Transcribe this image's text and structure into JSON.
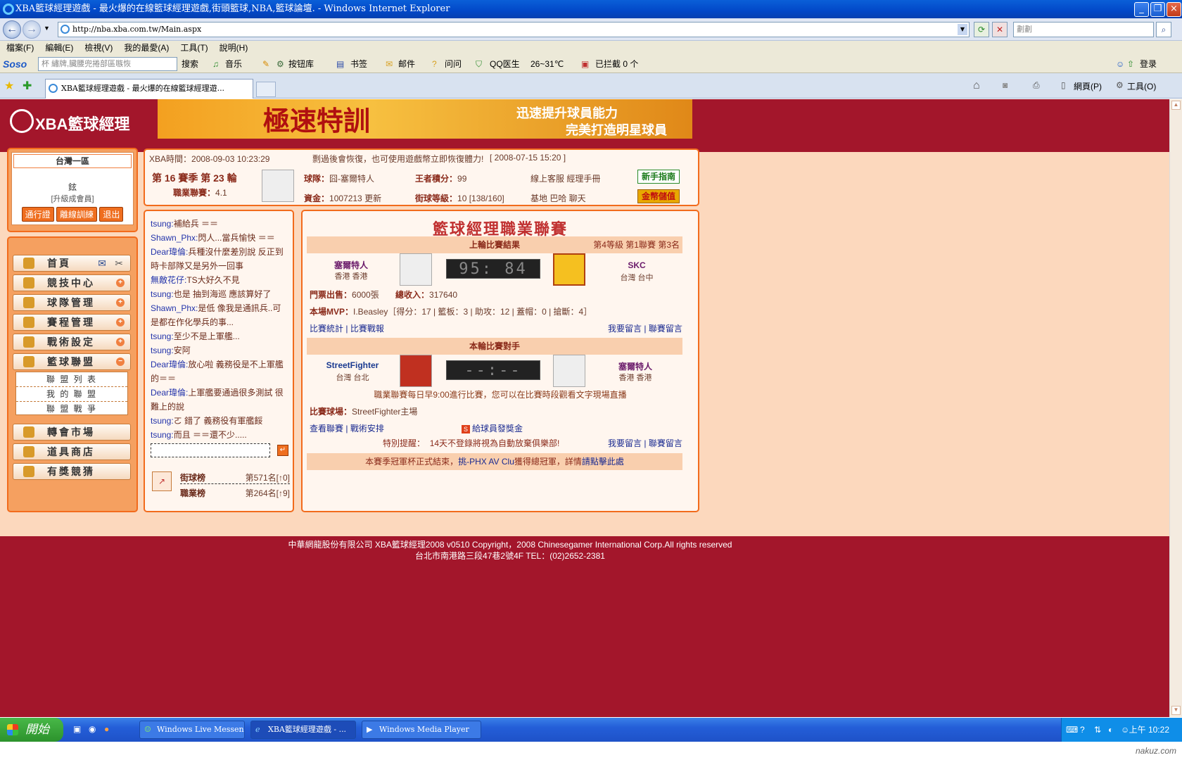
{
  "window": {
    "title": "XBA籃球經理遊戲 - 最火爆的在線籃球經理遊戲,街頭籃球,NBA,籃球論壇. - Windows Internet Explorer"
  },
  "browser": {
    "url": "http://nba.xba.com.tw/Main.aspx",
    "search_placeholder": "劃劃",
    "menu": [
      "檔案(F)",
      "編輯(E)",
      "檢視(V)",
      "我的最愛(A)",
      "工具(T)",
      "說明(H)"
    ],
    "soso": {
      "brand": "Soso",
      "input": "杯 繡牌,臟腰兜捲部區嗾恢",
      "search": "搜索",
      "music": "音乐",
      "bookmarks": "按钮库",
      "links": "书签",
      "mail": "邮件",
      "ask": "问问",
      "qq": "QQ医生",
      "weather": "26~31℃",
      "blocked": "已拦截 0 个",
      "login": "登录"
    },
    "tab": "XBA籃球經理遊戲 - 最火爆的在線籃球經理遊...",
    "page_menu": "網頁(P)",
    "tools_menu": "工具(O)"
  },
  "site": {
    "logo": "XBA籃球經理",
    "banner_title": "極速特訓",
    "banner_line1": "迅速提升球員能力",
    "banner_line2": "完美打造明星球員"
  },
  "left": {
    "server": "台灣一區",
    "user": "鉉",
    "upgrade": "[升級成會員]",
    "btns": [
      "通行證",
      "離線訓練",
      "退出"
    ],
    "menu": [
      "首頁",
      "競技中心",
      "球隊管理",
      "賽程管理",
      "戰術設定",
      "籃球聯盟",
      "轉會市場",
      "道具商店",
      "有獎競猜"
    ],
    "sub": [
      "聯 盟 列 表",
      "我 的 聯 盟",
      "聯 盟 戰 爭"
    ]
  },
  "info": {
    "time_label": "XBA時間：",
    "time": "2008-09-03 10:23:29",
    "notice": "剽過後會恢復，也可使用遊戲幣立即恢復體力!",
    "notice_date": "[ 2008-07-15 15:20 ]",
    "season": "第 16 賽季 第 23 輪",
    "league_label": "職業聯賽：",
    "league_val": "4.1",
    "team_label": "球隊：",
    "team_val": "囧-塞爾特人",
    "kings_label": "王者積分：",
    "kings_val": "99",
    "service": "線上客服 經理手冊",
    "money_label": "資金：",
    "money_val": "1007213",
    "update": "更新",
    "street_label": "街球等級：",
    "street_val": "10 [138/160]",
    "base": "基地 巴哈 聊天",
    "guide": "新手指南",
    "gold": "金幣儲值"
  },
  "chat": [
    {
      "u": "tsung:",
      "t": "補給兵 ＝＝"
    },
    {
      "u": "Shawn_Phx:",
      "t": "閃人...當兵愉快 ＝＝"
    },
    {
      "u": "Dear瑋倫:",
      "t": "兵種沒什麼差別說 反正到時卡部隊又是另外一回事"
    },
    {
      "u": "無敵花仔:",
      "t": "TS大好久不見"
    },
    {
      "u": "tsung:",
      "t": "也是 抽到海巡 應該算好了"
    },
    {
      "u": "Shawn_Phx:",
      "t": "是低 像我是通訊兵..可是都在作化學兵的事..."
    },
    {
      "u": "tsung:",
      "t": "至少不是上軍艦..."
    },
    {
      "u": "tsung:",
      "t": "安阿"
    },
    {
      "u": "Dear瑋倫:",
      "t": "放心啦 義務役是不上軍艦的＝＝"
    },
    {
      "u": "Dear瑋倫:",
      "t": "上軍艦要通過很多測試 很難上的說"
    },
    {
      "u": "tsung:",
      "t": "ㄛ 錯了 義務役有軍艦餒"
    },
    {
      "u": "tsung:",
      "t": "而且 ＝＝還不少....."
    }
  ],
  "rank": {
    "street": "街球榜",
    "street_v": "第571名[↑0]",
    "pro": "職業榜",
    "pro_v": "第264名[↑9]"
  },
  "main": {
    "title": "籃球經理職業聯賽",
    "last_result": "上輪比賽結果",
    "level_info": "第4等級 第1聯賽 第3名",
    "home": "塞爾特人",
    "home_loc": "香港 香港",
    "score": "95: 84",
    "away": "SKC",
    "away_loc": "台灣 台中",
    "tickets_label": "門票出售：",
    "tickets": "6000張",
    "income_label": "總收入：",
    "income": "317640",
    "mvp_label": "本場MVP：",
    "mvp": "I.Beasley［得分：17 | 籃板：3 | 助攻：12 | 蓋帽：0 | 搶斷：4］",
    "stats": "比賽統計",
    "report": "比賽戰報",
    "msg": "我要留言",
    "league_msg": "聯賽留言",
    "next": "本輪比賽對手",
    "opp": "StreetFighter",
    "opp_loc": "台灣 台北",
    "next_score": "--:--",
    "me": "塞爾特人",
    "me_loc": "香港 香港",
    "daily": "職業聯賽每日早9:00進行比賽，您可以在比賽時段觀看文字現場直播",
    "court_label": "比賽球場：",
    "court": "StreetFighter主場",
    "view_league": "查看聯賽",
    "tactics": "戰術安排",
    "bonus": "給球員發獎金",
    "remind_label": "特別提醒：",
    "remind": "14天不登錄將視為自動放棄俱樂部!",
    "champ": "本賽季冠軍杯正式結束，",
    "champ_team": "挑-PHX AV Clu",
    "champ2": "獲得總冠軍，詳情",
    "champ_link": "請點擊此處"
  },
  "footer": {
    "line1": "中華網龍股份有限公司  XBA籃球經理2008 v0510      Copyright，2008 Chinesegamer International Corp.All rights reserved",
    "line2": "台北市南港路三段47巷2號4F TEL：(02)2652-2381"
  },
  "taskbar": {
    "start": "開始",
    "tasks": [
      "Windows Live Messen...",
      "XBA籃球經理遊戲 - ...",
      "Windows Media Player"
    ],
    "clock": "上午 10:22",
    "watermark": "nakuz.com"
  }
}
